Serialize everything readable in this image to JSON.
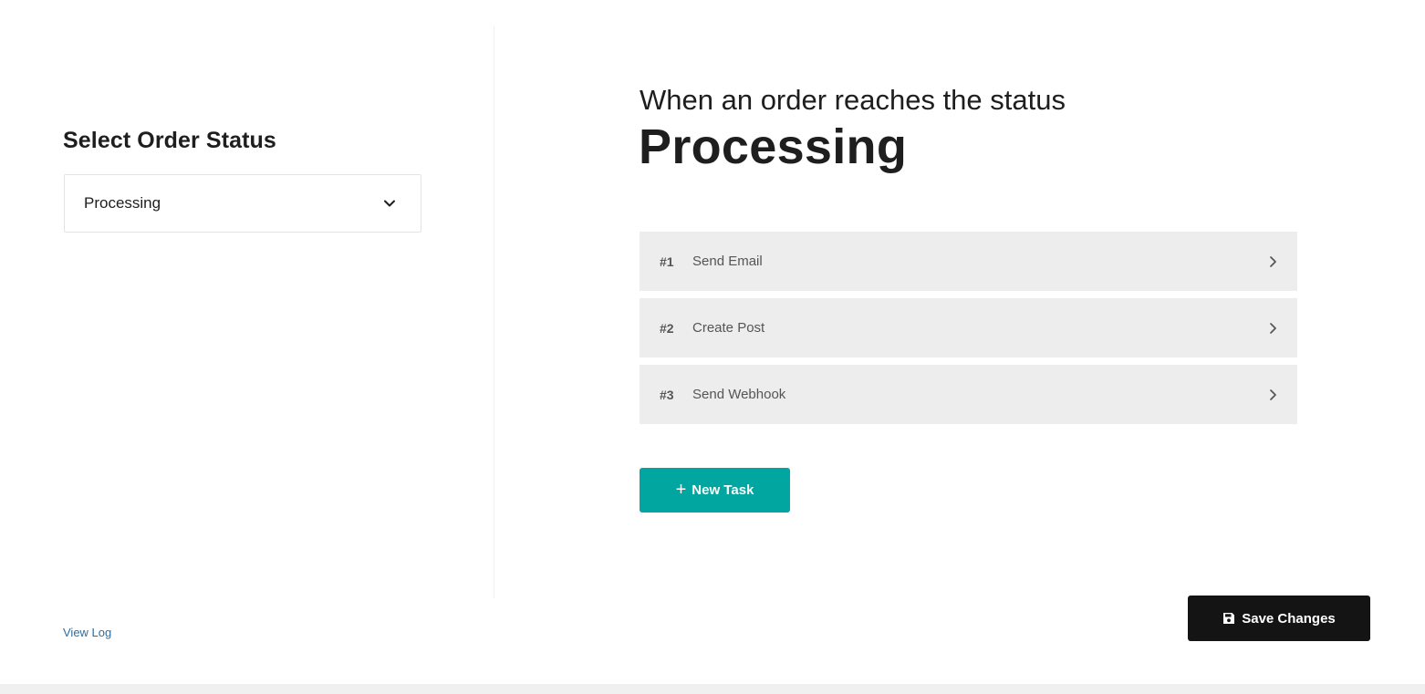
{
  "left": {
    "title": "Select Order Status",
    "status_select": {
      "value": "Processing"
    },
    "view_log": "View Log"
  },
  "right": {
    "heading_sub": "When an order reaches the status",
    "heading_main": "Processing",
    "tasks": [
      {
        "num": "#1",
        "name": "Send Email"
      },
      {
        "num": "#2",
        "name": "Create Post"
      },
      {
        "num": "#3",
        "name": "Send Webhook"
      }
    ],
    "new_task": {
      "icon": "+",
      "label": "New Task"
    }
  },
  "footer": {
    "save_label": "Save Changes"
  },
  "colors": {
    "accent": "#00a69f",
    "save_bg": "#141414",
    "task_bg": "#ededed",
    "link": "#2c6ea0"
  }
}
